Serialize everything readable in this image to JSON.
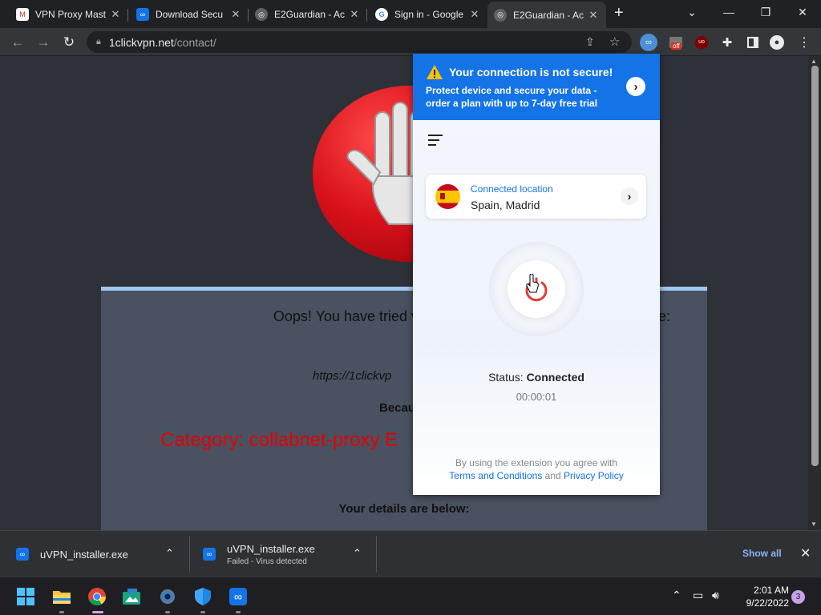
{
  "browser": {
    "tabs": [
      {
        "title": "VPN Proxy Mast",
        "favicon": "gmail-icon",
        "active": false
      },
      {
        "title": "Download Secu",
        "favicon": "uvpn-icon",
        "active": false
      },
      {
        "title": "E2Guardian - Ac",
        "favicon": "globe-icon",
        "active": false
      },
      {
        "title": "Sign in - Google",
        "favicon": "google-icon",
        "active": false
      },
      {
        "title": "E2Guardian - Ac",
        "favicon": "globe-icon",
        "active": true
      }
    ],
    "new_tab_symbol": "+",
    "url_host": "1clickvpn.net",
    "url_path": "/contact/",
    "extension_badge": "off"
  },
  "blocked_page": {
    "oops_text": "Oops! You have tried visiting a website w",
    "oops_text_tail": "te:",
    "blocked_url": "https://1clickvp",
    "because_text": "Becau",
    "category_text": "Category: collabnet-proxy  E",
    "details_text": "Your details are below:"
  },
  "vpn_popup": {
    "banner_title": "Your connection is not secure!",
    "banner_subtitle": "Protect device and secure your data - order a plan with up to 7-day free trial",
    "location_label": "Connected location",
    "location_value": "Spain, Madrid",
    "status_label": "Status:",
    "status_value": "Connected",
    "timer": "00:00:01",
    "legal_prefix": "By using the extension you agree with",
    "terms_link": "Terms and Conditions",
    "legal_and": "and",
    "privacy_link": "Privacy Policy",
    "accent_color": "#1473e6"
  },
  "downloads": {
    "items": [
      {
        "name": "uVPN_installer.exe",
        "status": ""
      },
      {
        "name": "uVPN_installer.exe",
        "status": "Failed - Virus detected"
      }
    ],
    "show_all": "Show all"
  },
  "taskbar": {
    "apps": [
      "windows-start",
      "file-explorer",
      "chrome",
      "photos",
      "settings",
      "windows-security",
      "uvpn"
    ],
    "time": "2:01 AM",
    "date": "9/22/2022",
    "notification_count": "3"
  }
}
